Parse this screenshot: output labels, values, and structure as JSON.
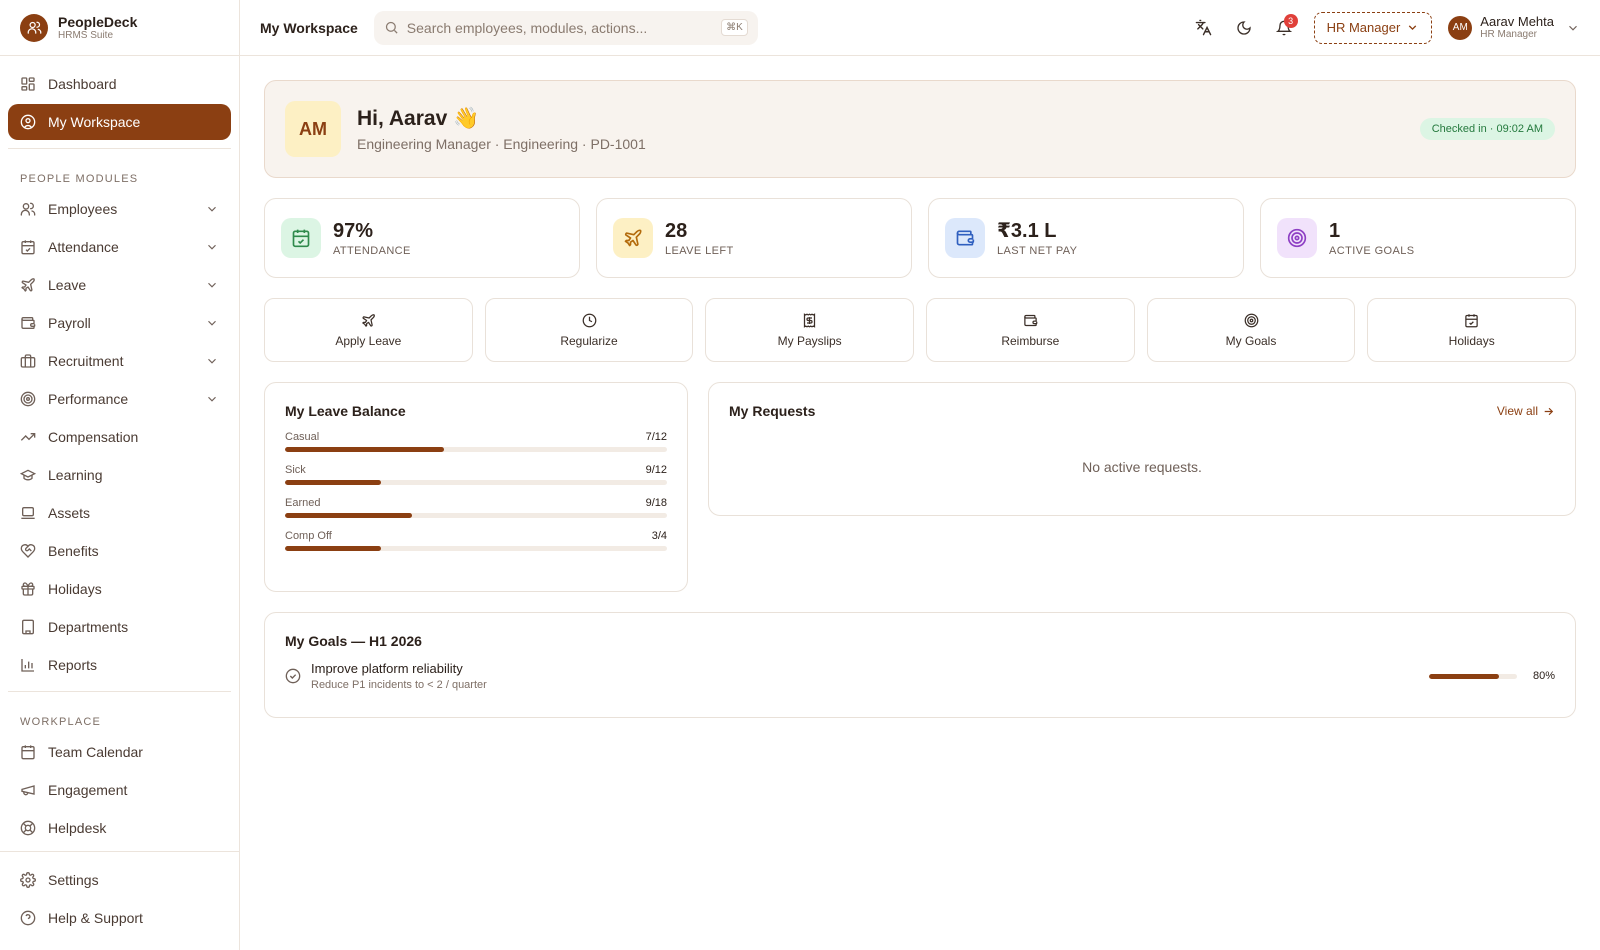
{
  "brand": {
    "name": "PeopleDeck",
    "subtitle": "HRMS Suite",
    "logo_icon": "users-icon"
  },
  "sidebar": {
    "main_items": [
      {
        "label": "Dashboard",
        "icon": "grid-icon",
        "active": false
      },
      {
        "label": "My Workspace",
        "icon": "user-circle-icon",
        "active": true
      }
    ],
    "people_title": "PEOPLE MODULES",
    "people_items": [
      {
        "label": "Employees",
        "icon": "users-icon"
      },
      {
        "label": "Attendance",
        "icon": "calendar-check-icon"
      },
      {
        "label": "Leave",
        "icon": "plane-icon"
      },
      {
        "label": "Payroll",
        "icon": "wallet-icon"
      },
      {
        "label": "Recruitment",
        "icon": "briefcase-icon"
      },
      {
        "label": "Performance",
        "icon": "target-icon"
      }
    ],
    "plain_items": [
      {
        "label": "Compensation",
        "icon": "trending-up-icon"
      },
      {
        "label": "Learning",
        "icon": "graduation-cap-icon"
      },
      {
        "label": "Assets",
        "icon": "laptop-icon"
      },
      {
        "label": "Benefits",
        "icon": "heart-handshake-icon"
      },
      {
        "label": "Holidays",
        "icon": "gift-icon"
      },
      {
        "label": "Departments",
        "icon": "building-icon"
      },
      {
        "label": "Reports",
        "icon": "bar-chart-icon"
      }
    ],
    "workplace_title": "WORKPLACE",
    "workplace_items": [
      {
        "label": "Team Calendar",
        "icon": "calendar-icon"
      },
      {
        "label": "Engagement",
        "icon": "megaphone-icon"
      },
      {
        "label": "Helpdesk",
        "icon": "life-buoy-icon"
      }
    ],
    "bottom_items": [
      {
        "label": "Settings",
        "icon": "gear-icon"
      },
      {
        "label": "Help & Support",
        "icon": "help-circle-icon"
      }
    ]
  },
  "topbar": {
    "title": "My Workspace",
    "search_placeholder": "Search employees, modules, actions...",
    "search_shortcut": "⌘K",
    "notification_count": "3",
    "role": "HR Manager",
    "user": {
      "initials": "AM",
      "name": "Aarav Mehta",
      "role": "HR Manager"
    }
  },
  "hero": {
    "initials": "AM",
    "greeting": "Hi, Aarav 👋",
    "subtitle": "Engineering Manager · Engineering · PD-1001",
    "checkin": "Checked in · 09:02 AM"
  },
  "stats": [
    {
      "value": "97%",
      "label": "ATTENDANCE",
      "icon": "calendar-check-icon",
      "bg": "#dcf5e4",
      "color": "#2f8a4c"
    },
    {
      "value": "28",
      "label": "LEAVE LEFT",
      "icon": "plane-icon",
      "bg": "#fdf0c4",
      "color": "#b36b0c"
    },
    {
      "value": "₹3.1 L",
      "label": "LAST NET PAY",
      "icon": "wallet-icon",
      "bg": "#dce8fb",
      "color": "#2f5fbf"
    },
    {
      "value": "1",
      "label": "ACTIVE GOALS",
      "icon": "target-icon",
      "bg": "#f1e2fb",
      "color": "#8e3fc4"
    }
  ],
  "actions": [
    {
      "label": "Apply Leave",
      "icon": "plane-icon"
    },
    {
      "label": "Regularize",
      "icon": "clock-icon"
    },
    {
      "label": "My Payslips",
      "icon": "receipt-icon"
    },
    {
      "label": "Reimburse",
      "icon": "wallet-icon"
    },
    {
      "label": "My Goals",
      "icon": "target-icon"
    },
    {
      "label": "Holidays",
      "icon": "calendar-icon"
    }
  ],
  "leave_balance": {
    "title": "My Leave Balance",
    "items": [
      {
        "type": "Casual",
        "text": "7/12",
        "fraction": 0.4167
      },
      {
        "type": "Sick",
        "text": "9/12",
        "fraction": 0.25
      },
      {
        "type": "Earned",
        "text": "9/18",
        "fraction": 0.3333
      },
      {
        "type": "Comp Off",
        "text": "3/4",
        "fraction": 0.25
      }
    ]
  },
  "requests": {
    "title": "My Requests",
    "view_all": "View all",
    "empty": "No active requests."
  },
  "goals": {
    "title": "My Goals — H1 2026",
    "items": [
      {
        "title": "Improve platform reliability",
        "subtitle": "Reduce P1 incidents to < 2 / quarter",
        "progress_text": "80%",
        "progress": 0.8
      }
    ]
  }
}
